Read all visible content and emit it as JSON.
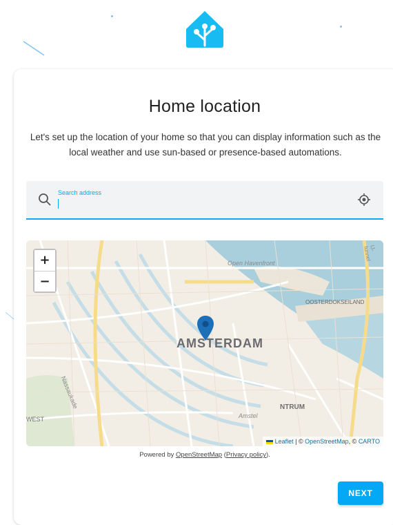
{
  "logo": {
    "icon": "home-assistant-logo",
    "color": "#18bcf2"
  },
  "card": {
    "title": "Home location",
    "description": "Let's set up the location of your home so that you can display information such as the local weather and use sun-based or presence-based automations."
  },
  "search": {
    "label": "Search address",
    "value": "",
    "search_icon": "search-icon",
    "locate_icon": "my-location-icon"
  },
  "map": {
    "zoom_in": "+",
    "zoom_out": "−",
    "city_label": "AMSTERDAM",
    "labels": {
      "haven": "Open Havenfront",
      "oosterdok": "OOSTERDOKSEILAND",
      "centrum": "NTRUM",
      "west": "WEST",
      "nassaukade": "Nassaukade",
      "amstel": "Amstel",
      "ij_tunnel": "IJ-tunnel"
    },
    "attribution": {
      "leaflet": "Leaflet",
      "sep1": " | © ",
      "osm": "OpenStreetMap",
      "sep2": ", © ",
      "carto": "CARTO"
    },
    "accent_water": "#a9cfdc",
    "marker_color": "#1d6fb8"
  },
  "footer": {
    "powered_prefix": "Powered by ",
    "powered_link": "OpenStreetMap",
    "privacy_open": " (",
    "privacy_link": "Privacy policy",
    "privacy_close": ")."
  },
  "actions": {
    "next": "NEXT"
  },
  "colors": {
    "primary": "#03a9f4"
  }
}
